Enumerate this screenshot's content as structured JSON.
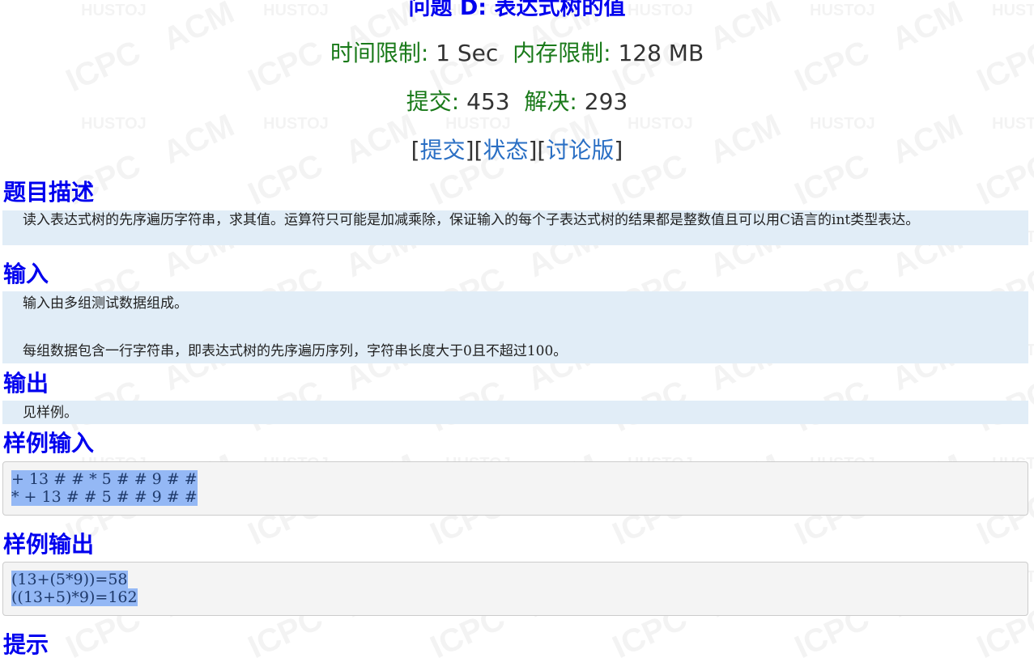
{
  "problem": {
    "title": "问题 D: 表达式树的值",
    "time_limit_label": "时间限制:",
    "time_limit_value": "1 Sec",
    "memory_limit_label": "内存限制:",
    "memory_limit_value": "128 MB",
    "submit_label": "提交:",
    "submit_count": "453",
    "solved_label": "解决:",
    "solved_count": "293"
  },
  "links": {
    "submit": "提交",
    "status": "状态",
    "discuss": "讨论版"
  },
  "sections": {
    "description_title": "题目描述",
    "description_text": "读入表达式树的先序遍历字符串，求其值。运算符只可能是加减乘除，保证输入的每个子表达式树的结果都是整数值且可以用C语言的int类型表达。",
    "input_title": "输入",
    "input_line1": "输入由多组测试数据组成。",
    "input_line2": "每组数据包含一行字符串，即表达式树的先序遍历序列，字符串长度大于0且不超过100。",
    "output_title": "输出",
    "output_text": "见样例。",
    "sample_input_title": "样例输入",
    "sample_input_lines": [
      "+ 13 # # * 5 # # 9 # #",
      "* + 13 # # 5 # # 9 # #"
    ],
    "sample_output_title": "样例输出",
    "sample_output_lines": [
      "(13+(5*9))=58",
      "((13+5)*9)=162"
    ],
    "hint_title": "提示"
  },
  "watermark": {
    "words": [
      "HUSTOJ",
      "ACM",
      "ICPC"
    ]
  }
}
